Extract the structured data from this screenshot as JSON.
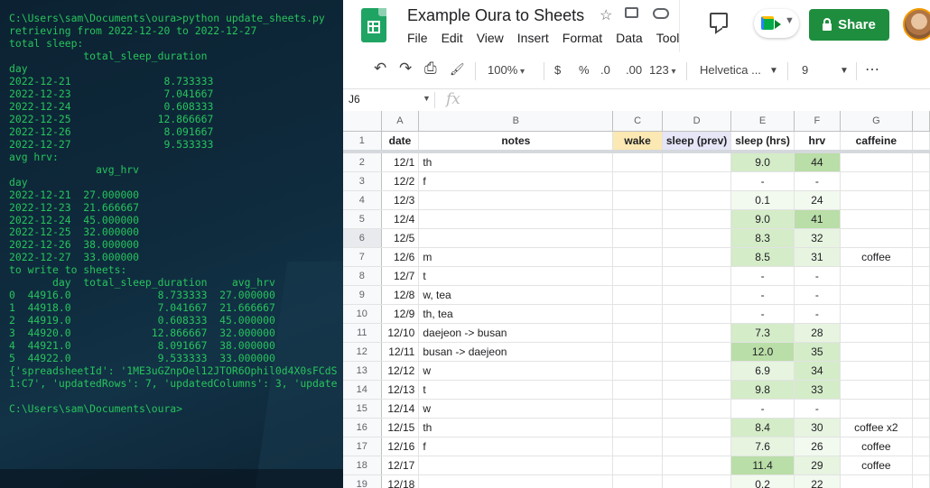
{
  "terminal": {
    "lines": [
      "C:\\Users\\sam\\Documents\\oura>python update_sheets.py",
      "retrieving from 2022-12-20 to 2022-12-27",
      "total sleep:",
      "            total_sleep_duration",
      "day",
      "2022-12-21               8.733333",
      "2022-12-23               7.041667",
      "2022-12-24               0.608333",
      "2022-12-25              12.866667",
      "2022-12-26               8.091667",
      "2022-12-27               9.533333",
      "avg hrv:",
      "              avg_hrv",
      "day",
      "2022-12-21  27.000000",
      "2022-12-23  21.666667",
      "2022-12-24  45.000000",
      "2022-12-25  32.000000",
      "2022-12-26  38.000000",
      "2022-12-27  33.000000",
      "to write to sheets:",
      "       day  total_sleep_duration    avg_hrv",
      "0  44916.0              8.733333  27.000000",
      "1  44918.0              7.041667  21.666667",
      "2  44919.0              0.608333  45.000000",
      "3  44920.0             12.866667  32.000000",
      "4  44921.0              8.091667  38.000000",
      "5  44922.0              9.533333  33.000000",
      "{'spreadsheetId': '1ME3uGZnpOel12JTOR6Ophil0d4X0sFCdS",
      "1:C7', 'updatedRows': 7, 'updatedColumns': 3, 'update",
      "",
      "C:\\Users\\sam\\Documents\\oura>"
    ]
  },
  "sheets": {
    "title": "Example Oura to Sheets",
    "menu": [
      "File",
      "Edit",
      "View",
      "Insert",
      "Format",
      "Data",
      "Tool"
    ],
    "share_label": "Share",
    "toolbar": {
      "undo": "↶",
      "redo": "↷",
      "print": "⎙",
      "paint": "🖌",
      "zoom": "100%",
      "currency": "$",
      "percent": "%",
      "dec_less": ".0",
      "dec_more": ".00",
      "format_more": "123",
      "font": "Helvetica ...",
      "font_size": "9",
      "more": "⋯"
    },
    "name_box": "J6",
    "fx": "fx",
    "columns": [
      "A",
      "B",
      "C",
      "D",
      "E",
      "F",
      "G"
    ],
    "header_row": {
      "num": "1",
      "cells": [
        "date",
        "notes",
        "wake",
        "sleep (prev)",
        "sleep (hrs)",
        "hrv",
        "caffeine"
      ]
    },
    "rows": [
      {
        "num": "2",
        "date": "12/1",
        "notes": "th",
        "wake": "",
        "sleep_prev": "",
        "sleep": "9.0",
        "hrv": "44",
        "caffeine": ""
      },
      {
        "num": "3",
        "date": "12/2",
        "notes": "f",
        "wake": "",
        "sleep_prev": "",
        "sleep": "-",
        "hrv": "-",
        "caffeine": ""
      },
      {
        "num": "4",
        "date": "12/3",
        "notes": "",
        "wake": "",
        "sleep_prev": "",
        "sleep": "0.1",
        "hrv": "24",
        "caffeine": ""
      },
      {
        "num": "5",
        "date": "12/4",
        "notes": "",
        "wake": "",
        "sleep_prev": "",
        "sleep": "9.0",
        "hrv": "41",
        "caffeine": ""
      },
      {
        "num": "6",
        "date": "12/5",
        "notes": "",
        "wake": "",
        "sleep_prev": "",
        "sleep": "8.3",
        "hrv": "32",
        "caffeine": ""
      },
      {
        "num": "7",
        "date": "12/6",
        "notes": "m",
        "wake": "",
        "sleep_prev": "",
        "sleep": "8.5",
        "hrv": "31",
        "caffeine": "coffee"
      },
      {
        "num": "8",
        "date": "12/7",
        "notes": "t",
        "wake": "",
        "sleep_prev": "",
        "sleep": "-",
        "hrv": "-",
        "caffeine": ""
      },
      {
        "num": "9",
        "date": "12/8",
        "notes": "w, tea",
        "wake": "",
        "sleep_prev": "",
        "sleep": "-",
        "hrv": "-",
        "caffeine": ""
      },
      {
        "num": "10",
        "date": "12/9",
        "notes": "th, tea",
        "wake": "",
        "sleep_prev": "",
        "sleep": "-",
        "hrv": "-",
        "caffeine": ""
      },
      {
        "num": "11",
        "date": "12/10",
        "notes": "daejeon -> busan",
        "wake": "",
        "sleep_prev": "",
        "sleep": "7.3",
        "hrv": "28",
        "caffeine": ""
      },
      {
        "num": "12",
        "date": "12/11",
        "notes": "busan -> daejeon",
        "wake": "",
        "sleep_prev": "",
        "sleep": "12.0",
        "hrv": "35",
        "caffeine": ""
      },
      {
        "num": "13",
        "date": "12/12",
        "notes": "w",
        "wake": "",
        "sleep_prev": "",
        "sleep": "6.9",
        "hrv": "34",
        "caffeine": ""
      },
      {
        "num": "14",
        "date": "12/13",
        "notes": "t",
        "wake": "",
        "sleep_prev": "",
        "sleep": "9.8",
        "hrv": "33",
        "caffeine": ""
      },
      {
        "num": "15",
        "date": "12/14",
        "notes": "w",
        "wake": "",
        "sleep_prev": "",
        "sleep": "-",
        "hrv": "-",
        "caffeine": ""
      },
      {
        "num": "16",
        "date": "12/15",
        "notes": "th",
        "wake": "",
        "sleep_prev": "",
        "sleep": "8.4",
        "hrv": "30",
        "caffeine": "coffee x2"
      },
      {
        "num": "17",
        "date": "12/16",
        "notes": "f",
        "wake": "",
        "sleep_prev": "",
        "sleep": "7.6",
        "hrv": "26",
        "caffeine": "coffee"
      },
      {
        "num": "18",
        "date": "12/17",
        "notes": "",
        "wake": "",
        "sleep_prev": "",
        "sleep": "11.4",
        "hrv": "29",
        "caffeine": "coffee"
      },
      {
        "num": "19",
        "date": "12/18",
        "notes": "",
        "wake": "",
        "sleep_prev": "",
        "sleep": "0.2",
        "hrv": "22",
        "caffeine": ""
      }
    ],
    "colors": {
      "share": "#1e8e3e",
      "wake_header": "#fce8b2",
      "sleep_prev_header": "#e6e6f7",
      "terminal_text": "#27c45c"
    }
  }
}
